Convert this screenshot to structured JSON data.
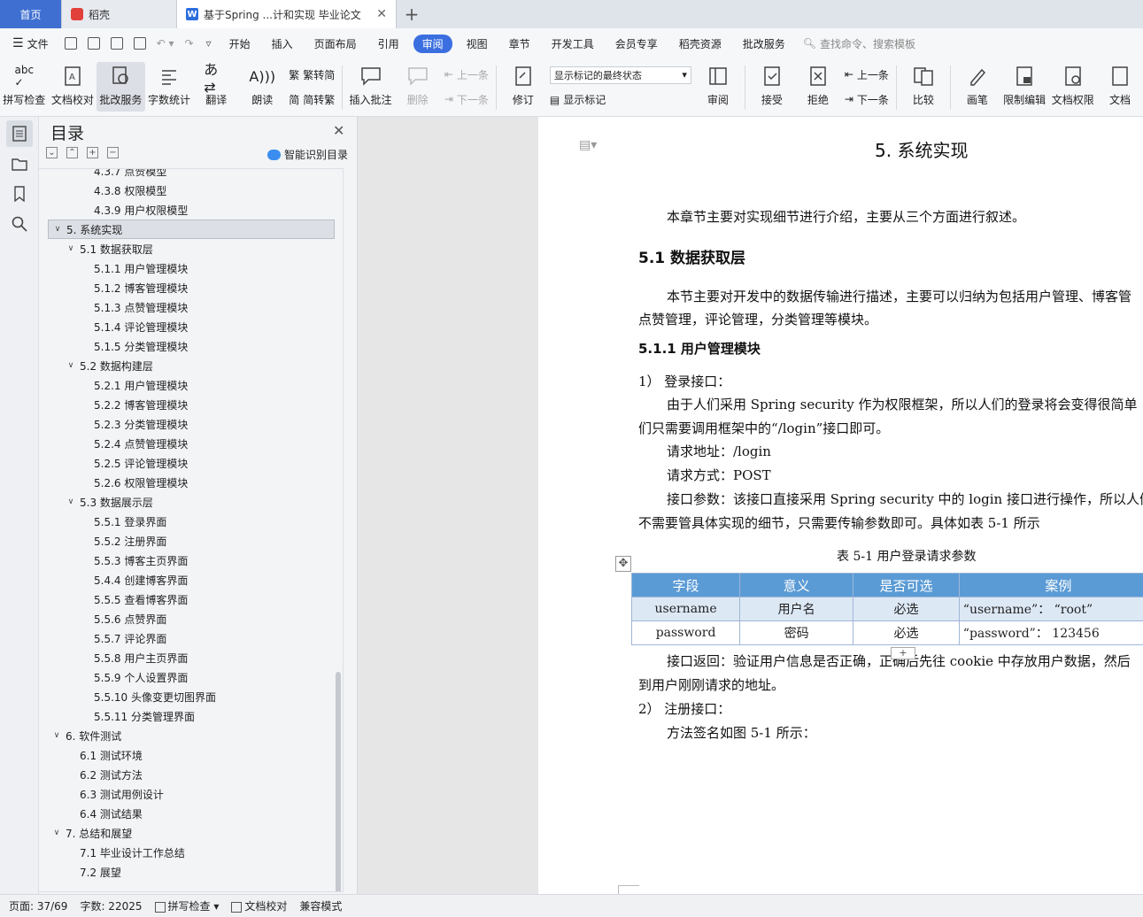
{
  "tabs": {
    "home": "首页",
    "dk": "稻壳",
    "doc": "基于Spring ...计和实现 毕业论文"
  },
  "menu": {
    "file": "文件",
    "items": [
      "开始",
      "插入",
      "页面布局",
      "引用",
      "审阅",
      "视图",
      "章节",
      "开发工具",
      "会员专享",
      "稻壳资源",
      "批改服务"
    ],
    "active": "审阅",
    "search": "查找命令、搜索模板"
  },
  "ribbon": {
    "spell": "拼写检查",
    "proof": "文档校对",
    "batch": "批改服务",
    "count": "字数统计",
    "translate": "翻译",
    "read": "朗读",
    "trad": "繁转简",
    "simp": "简转繁",
    "comment": "插入批注",
    "delete": "删除",
    "prev": "上一条",
    "next": "下一条",
    "revise": "修订",
    "markstate": "显示标记的最终状态",
    "showmark": "显示标记",
    "review": "审阅",
    "accept": "接受",
    "reject": "拒绝",
    "prev2": "上一条",
    "next2": "下一条",
    "compare": "比较",
    "pen": "画笔",
    "restrict": "限制编辑",
    "perm": "文档权限",
    "docs": "文档"
  },
  "toc": {
    "title": "目录",
    "smart": "智能识别目录",
    "items": [
      {
        "t": "4.3.7 点赞模型",
        "l": 3
      },
      {
        "t": "4.3.8 权限模型",
        "l": 3
      },
      {
        "t": "4.3.9 用户权限模型",
        "l": 3
      },
      {
        "t": "5.  系统实现",
        "l": 1,
        "sel": true
      },
      {
        "t": "5.1  数据获取层",
        "l": 2
      },
      {
        "t": "5.1.1  用户管理模块",
        "l": 3
      },
      {
        "t": "5.1.2  博客管理模块",
        "l": 3
      },
      {
        "t": "5.1.3  点赞管理模块",
        "l": 3
      },
      {
        "t": "5.1.4 评论管理模块",
        "l": 3
      },
      {
        "t": "5.1.5 分类管理模块",
        "l": 3
      },
      {
        "t": "5.2  数据构建层",
        "l": 2
      },
      {
        "t": "5.2.1  用户管理模块",
        "l": 3
      },
      {
        "t": "5.2.2  博客管理模块",
        "l": 3
      },
      {
        "t": "5.2.3  分类管理模块",
        "l": 3
      },
      {
        "t": "5.2.4  点赞管理模块",
        "l": 3
      },
      {
        "t": "5.2.5  评论管理模块",
        "l": 3
      },
      {
        "t": "5.2.6  权限管理模块",
        "l": 3
      },
      {
        "t": "5.3  数据展示层",
        "l": 2
      },
      {
        "t": "5.5.1 登录界面",
        "l": 3
      },
      {
        "t": "5.5.2 注册界面",
        "l": 3
      },
      {
        "t": "5.5.3 博客主页界面",
        "l": 3
      },
      {
        "t": "5.4.4 创建博客界面",
        "l": 3
      },
      {
        "t": "5.5.5 查看博客界面",
        "l": 3
      },
      {
        "t": "5.5.6 点赞界面",
        "l": 3
      },
      {
        "t": "5.5.7 评论界面",
        "l": 3
      },
      {
        "t": "5.5.8 用户主页界面",
        "l": 3
      },
      {
        "t": "5.5.9 个人设置界面",
        "l": 3
      },
      {
        "t": "5.5.10 头像变更切图界面",
        "l": 3
      },
      {
        "t": "5.5.11 分类管理界面",
        "l": 3
      },
      {
        "t": "6.  软件测试",
        "l": 1
      },
      {
        "t": "6.1  测试环境",
        "l": 2,
        "nocar": true
      },
      {
        "t": "6.2  测试方法",
        "l": 2,
        "nocar": true
      },
      {
        "t": "6.3  测试用例设计",
        "l": 2,
        "nocar": true
      },
      {
        "t": "6.4  测试结果",
        "l": 2,
        "nocar": true
      },
      {
        "t": "7.  总结和展望",
        "l": 1
      },
      {
        "t": "7.1  毕业设计工作总结",
        "l": 2,
        "nocar": true
      },
      {
        "t": "7.2  展望",
        "l": 2,
        "nocar": true
      }
    ]
  },
  "doc": {
    "h1": "5.  系统实现",
    "intro": "本章节主要对实现细节进行介绍，主要从三个方面进行叙述。",
    "h2": "5.1  数据获取层",
    "p1a": "本节主要对开发中的数据传输进行描述，主要可以归纳为包括用户管理、博客管",
    "p1b": "点赞管理，评论管理，分类管理等模块。",
    "h3": "5.1.1  用户管理模块",
    "li1": "1）  登录接口：",
    "p2a": "由于人们采用 Spring security 作为权限框架，所以人们的登录将会变得很简单",
    "p2b": "们只需要调用框架中的“/login”接口即可。",
    "addr": "请求地址：/login",
    "method": "请求方式：POST",
    "p3a": "接口参数：该接口直接采用 Spring security 中的 login 接口进行操作，所以人们",
    "p3b": "不需要管具体实现的细节，只需要传输参数即可。具体如表 5-1 所示",
    "caption": "表 5-1  用户登录请求参数",
    "table": {
      "head": [
        "字段",
        "意义",
        "是否可选",
        "案例"
      ],
      "rows": [
        [
          "username",
          "用户名",
          "必选",
          "“username”：  “root”"
        ],
        [
          "password",
          "密码",
          "必选",
          "“password”：   123456"
        ]
      ]
    },
    "p4a": "接口返回：验证用户信息是否正确，正确后先往 cookie 中存放用户数据，然后",
    "p4b": "到用户刚刚请求的地址。",
    "li2": "2）  注册接口：",
    "p5": "方法签名如图 5-1 所示："
  },
  "status": {
    "page": "页面: 37/69",
    "words": "字数: 22025",
    "spell": "拼写检查",
    "proof": "文档校对",
    "compat": "兼容模式"
  }
}
